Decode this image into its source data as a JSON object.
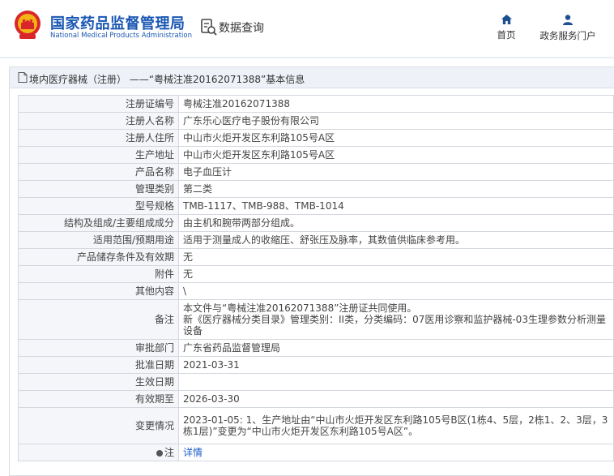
{
  "header": {
    "logo_cn": "国家药品监督管理局",
    "logo_en": "National Medical Products Administration",
    "query_label": "数据查询",
    "nav": [
      {
        "label": "首页",
        "icon": "home-icon"
      },
      {
        "label": "政务服务门户",
        "icon": "user-icon"
      }
    ]
  },
  "panel": {
    "title": "境内医疗器械（注册） ——“粤械注准20162071388”基本信息"
  },
  "rows": [
    {
      "label": "注册证编号",
      "value": "粤械注准20162071388"
    },
    {
      "label": "注册人名称",
      "value": "广东乐心医疗电子股份有限公司"
    },
    {
      "label": "注册人住所",
      "value": "中山市火炬开发区东利路105号A区"
    },
    {
      "label": "生产地址",
      "value": "中山市火炬开发区东利路105号A区"
    },
    {
      "label": "产品名称",
      "value": "电子血压计"
    },
    {
      "label": "管理类别",
      "value": "第二类"
    },
    {
      "label": "型号规格",
      "value": "TMB-1117、TMB-988、TMB-1014"
    },
    {
      "label": "结构及组成/主要组成成分",
      "value": "由主机和腕带两部分组成。"
    },
    {
      "label": "适用范围/预期用途",
      "value": "适用于测量成人的收缩压、舒张压及脉率，其数值供临床参考用。"
    },
    {
      "label": "产品储存条件及有效期",
      "value": "无"
    },
    {
      "label": "附件",
      "value": "无"
    },
    {
      "label": "其他内容",
      "value": "\\"
    },
    {
      "label": "备注",
      "value_line1": "本文件与“粤械注准20162071388”注册证共同使用。",
      "value_line2": "新《医疗器械分类目录》管理类别：II类，分类编码：07医用诊察和监护器械-03生理参数分析测量设备"
    },
    {
      "label": "审批部门",
      "value": "广东省药品监督管理局"
    },
    {
      "label": "批准日期",
      "value": "2021-03-31"
    },
    {
      "label": "生效日期",
      "value": ""
    },
    {
      "label": "有效期至",
      "value": "2026-03-30"
    },
    {
      "label": "变更情况",
      "value": "2023-01-05: 1、生产地址由“中山市火炬开发区东利路105号B区(1栋4、5层，2栋1、2、3层，3栋1层)”变更为“中山市火炬开发区东利路105号A区”。"
    },
    {
      "label": "注",
      "value": "详情"
    }
  ]
}
